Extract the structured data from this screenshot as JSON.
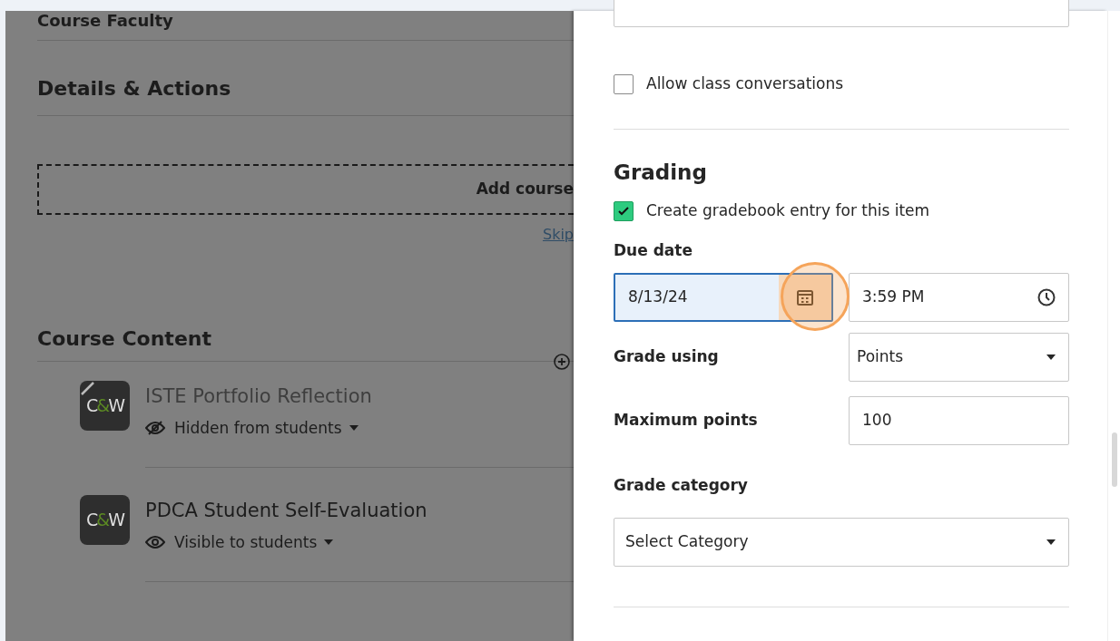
{
  "background": {
    "sections": [
      {
        "title": "Course Faculty"
      },
      {
        "title": "Details & Actions"
      }
    ],
    "banner": {
      "text": "Add course",
      "link": "Skip"
    },
    "content": {
      "title": "Course Content",
      "items": [
        {
          "logo": "C&W",
          "title": "ISTE Portfolio Reflection",
          "visible": false,
          "status": "Hidden from students"
        },
        {
          "logo": "C&W",
          "title": "PDCA Student Self-Evaluation",
          "visible": true,
          "status": "Visible to students"
        }
      ]
    }
  },
  "panel": {
    "conversations": {
      "label": "Allow class conversations",
      "checked": false
    },
    "grading": {
      "title": "Grading",
      "gradebook": {
        "label": "Create gradebook entry for this item",
        "checked": true
      },
      "due_label": "Due date",
      "date": "8/13/24",
      "time": "3:59 PM",
      "grade_using": {
        "label": "Grade using",
        "value": "Points"
      },
      "max_points": {
        "label": "Maximum points",
        "value": "100"
      },
      "category": {
        "label": "Grade category",
        "value": "Select Category"
      }
    }
  }
}
